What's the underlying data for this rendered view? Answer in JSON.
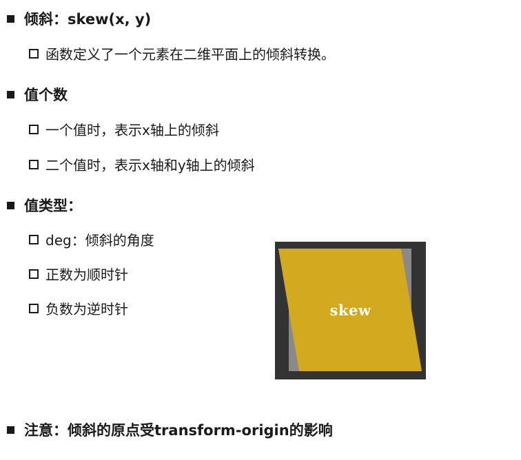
{
  "sections": [
    {
      "heading": "倾斜：skew(x, y)",
      "items": [
        "函数定义了一个元素在二维平面上的倾斜转换。"
      ]
    },
    {
      "heading": "值个数",
      "items": [
        "一个值时，表示x轴上的倾斜",
        "二个值时，表示x轴和y轴上的倾斜"
      ]
    },
    {
      "heading": "值类型：",
      "items": [
        "deg：倾斜的角度",
        "正数为顺时针",
        "负数为逆时针"
      ]
    },
    {
      "heading": "注意：倾斜的原点受transform-origin的影响",
      "items": []
    }
  ],
  "demo": {
    "label": "skew",
    "colors": {
      "background": "#333333",
      "ghost": "#8a8a8a",
      "shape": "#d3aa1f"
    }
  }
}
